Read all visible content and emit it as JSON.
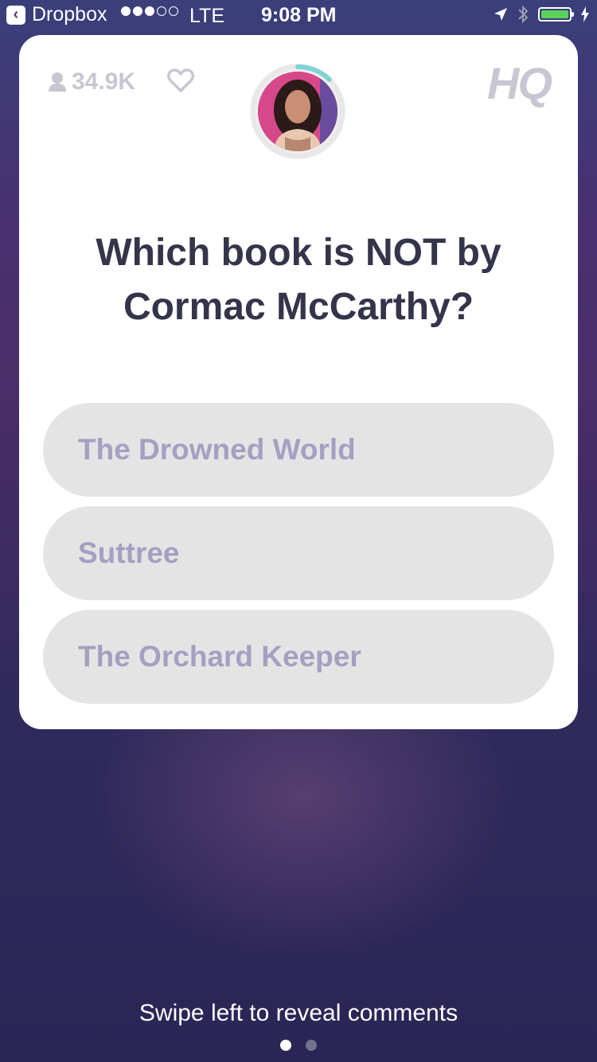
{
  "status_bar": {
    "back_app": "Dropbox",
    "carrier": "LTE",
    "time": "9:08 PM",
    "signal_bars_filled": 3,
    "signal_bars_total": 5,
    "battery_level": 1.0
  },
  "header": {
    "viewer_count": "34.9K",
    "logo": "HQ"
  },
  "question": {
    "text": "Which book is NOT by Cormac McCarthy?"
  },
  "answers": [
    {
      "label": "The Drowned World"
    },
    {
      "label": "Suttree"
    },
    {
      "label": "The Orchard Keeper"
    }
  ],
  "footer": {
    "hint": "Swipe left to reveal comments",
    "page_index": 1,
    "page_count": 2
  },
  "colors": {
    "answer_bg": "#e4e4e4",
    "answer_text": "#a4a0c2",
    "question_text": "#34344a",
    "timer_ring": "#7fd3d3"
  }
}
